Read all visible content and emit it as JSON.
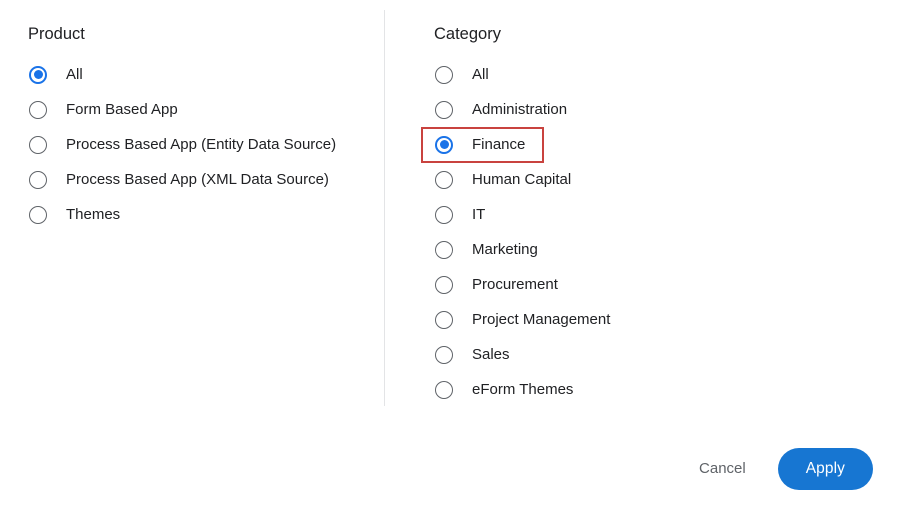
{
  "colors": {
    "accent": "#1a73e8",
    "apply_button_bg": "#1776d2",
    "highlight_box": "#c9433f",
    "text": "#202124",
    "muted_text": "#5f6368",
    "divider": "#e3e4e6"
  },
  "product": {
    "title": "Product",
    "options": [
      {
        "label": "All",
        "selected": true
      },
      {
        "label": "Form Based App",
        "selected": false
      },
      {
        "label": "Process Based App (Entity Data Source)",
        "selected": false
      },
      {
        "label": "Process Based App (XML Data Source)",
        "selected": false
      },
      {
        "label": "Themes",
        "selected": false
      }
    ]
  },
  "category": {
    "title": "Category",
    "options": [
      {
        "label": "All",
        "selected": false,
        "highlighted": false
      },
      {
        "label": "Administration",
        "selected": false,
        "highlighted": false
      },
      {
        "label": "Finance",
        "selected": true,
        "highlighted": true
      },
      {
        "label": "Human Capital",
        "selected": false,
        "highlighted": false
      },
      {
        "label": "IT",
        "selected": false,
        "highlighted": false
      },
      {
        "label": "Marketing",
        "selected": false,
        "highlighted": false
      },
      {
        "label": "Procurement",
        "selected": false,
        "highlighted": false
      },
      {
        "label": "Project Management",
        "selected": false,
        "highlighted": false
      },
      {
        "label": "Sales",
        "selected": false,
        "highlighted": false
      },
      {
        "label": "eForm Themes",
        "selected": false,
        "highlighted": false
      }
    ]
  },
  "footer": {
    "cancel_label": "Cancel",
    "apply_label": "Apply"
  }
}
